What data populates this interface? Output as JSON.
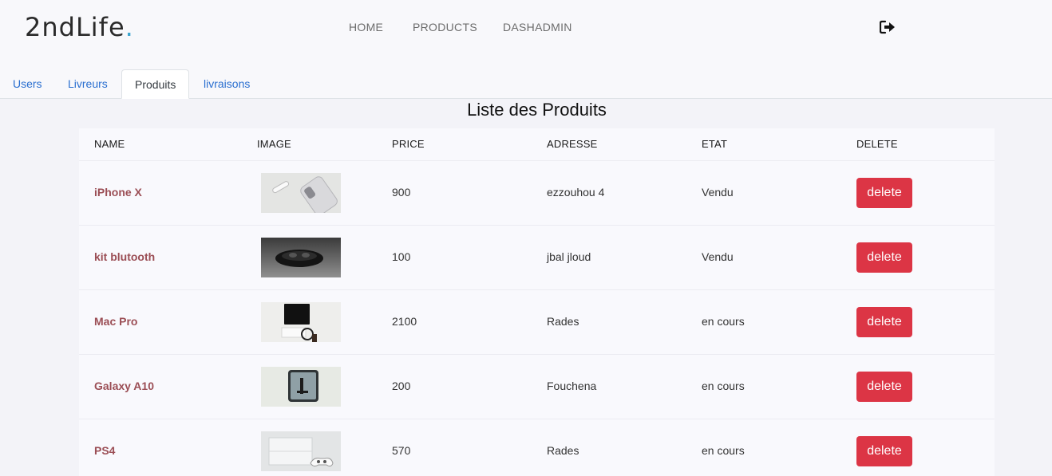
{
  "navbar": {
    "brand_text": "2ndLife",
    "brand_dot": ".",
    "links": [
      "HOME",
      "PRODUCTS",
      "DASHADMIN"
    ],
    "logout_icon": "sign-out-icon"
  },
  "tabs": {
    "items": [
      "Users",
      "Livreurs",
      "Produits",
      "livraisons"
    ],
    "active": "Produits"
  },
  "page": {
    "title": "Liste des Produits"
  },
  "table": {
    "headers": [
      "NAME",
      "IMAGE",
      "PRICE",
      "ADRESSE",
      "ETAT",
      "DELETE"
    ],
    "rows": [
      {
        "name": "iPhone X",
        "image": "iphone-x-photo",
        "price": "900",
        "adresse": "ezzouhou 4",
        "etat": "Vendu",
        "delete": "delete"
      },
      {
        "name": "kit blutooth",
        "image": "bluetooth-earbuds-photo",
        "price": "100",
        "adresse": "jbal jloud",
        "etat": "Vendu",
        "delete": "delete"
      },
      {
        "name": "Mac Pro",
        "image": "mac-pro-photo",
        "price": "2100",
        "adresse": "Rades",
        "etat": "en cours",
        "delete": "delete"
      },
      {
        "name": "Galaxy A10",
        "image": "galaxy-a10-photo",
        "price": "200",
        "adresse": "Fouchena",
        "etat": "en cours",
        "delete": "delete"
      },
      {
        "name": "PS4",
        "image": "ps4-photo",
        "price": "570",
        "adresse": "Rades",
        "etat": "en cours",
        "delete": "delete"
      }
    ]
  },
  "colors": {
    "accent_link": "#2a6fd0",
    "product_name": "#9b4e55",
    "delete_button": "#dc3545",
    "brand_dot": "#3aa5cf"
  }
}
